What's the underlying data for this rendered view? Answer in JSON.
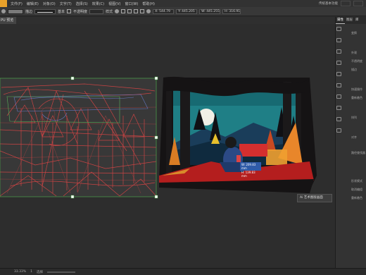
{
  "menubar": {
    "items": [
      "文件(F)",
      "编辑(E)",
      "对象(O)",
      "文字(T)",
      "选择(S)",
      "效果(C)",
      "视图(V)",
      "窗口(W)",
      "帮助(H)"
    ],
    "right_label": "传统基本功能"
  },
  "control_bar": {
    "stroke_label": "描边",
    "style_label": "基本",
    "opacity_label": "不透明度",
    "style2_label": "样式",
    "x_value": "X: 544.79",
    "y_value": "Y: 445.205",
    "w_value": "W: 445.255",
    "h_value": "H: 316.91"
  },
  "tabs": {
    "doc_tab": "PU 预览"
  },
  "right_panel": {
    "tabs": [
      "属性",
      "图层",
      "库"
    ],
    "labels": [
      "变换",
      "外观",
      "不透明度",
      "描边",
      "快速操作",
      "重新着色",
      "排列",
      "对齐",
      "路径查找器",
      "形状模式",
      "取消编组",
      "重新着色"
    ]
  },
  "measure": {
    "w": "W: 209.83 mm",
    "h": "H: 139.83 mm"
  },
  "tooltip": {
    "text": "Ai 艺术图版画面"
  },
  "statusbar": {
    "zoom": "33.33%",
    "page": "1",
    "tool": "选择"
  },
  "colors": {
    "sketch": "#e04848",
    "selection": "#4ca64c",
    "sky": "#1f7f86",
    "tree": "#1d1b1c",
    "glow": "#e8862a",
    "jacket": "#2c4a86",
    "ground": "#b41e1e"
  }
}
